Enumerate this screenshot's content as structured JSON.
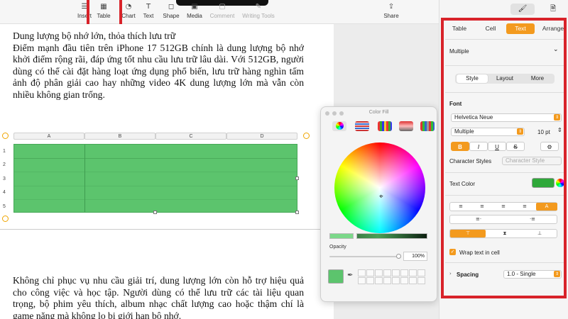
{
  "toolbar": {
    "items": [
      {
        "label": "Insert",
        "icon": "insert-icon"
      },
      {
        "label": "Table",
        "icon": "table-icon"
      },
      {
        "label": "Chart",
        "icon": "chart-icon"
      },
      {
        "label": "Text",
        "icon": "text-icon"
      },
      {
        "label": "Shape",
        "icon": "shape-icon"
      },
      {
        "label": "Media",
        "icon": "media-icon"
      },
      {
        "label": "Comment",
        "icon": "comment-icon"
      },
      {
        "label": "Writing Tools",
        "icon": "writing-tools-icon"
      },
      {
        "label": "Share",
        "icon": "share-icon"
      }
    ]
  },
  "document": {
    "heading": "Dung lượng bộ nhớ lớn, thỏa thích lưu trữ",
    "paragraph1": "Điểm mạnh đầu tiên trên iPhone 17 512GB chính là dung lượng bộ nhớ khởi điểm rộng rãi, đáp ứng tốt nhu cầu lưu trữ lâu dài. Với 512GB, người dùng có thể cài đặt hàng loạt ứng dụng phổ biến, lưu trữ hàng nghìn tấm ảnh độ phân giải cao hay những video 4K dung lượng lớn mà vẫn còn nhiều không gian trống.",
    "paragraph2": "Không chỉ phục vụ nhu cầu giải trí, dung lượng lớn còn hỗ trợ hiệu quả cho công việc và học tập. Người dùng có thể lưu trữ các tài liệu quan trọng, bộ phim yêu thích, album nhạc chất lượng cao hoặc thậm chí là game nặng mà không lo bị giới hạn bộ nhớ.",
    "table": {
      "columns": [
        "A",
        "B",
        "C",
        "D"
      ],
      "rows": [
        "1",
        "2",
        "3",
        "4",
        "5"
      ],
      "fill_color": "#5cc46d"
    }
  },
  "color_fill": {
    "title": "Color Fill",
    "opacity_label": "Opacity",
    "opacity_value": "100%",
    "current_color": "#5cc46d"
  },
  "format_panel": {
    "tabs": [
      "Table",
      "Cell",
      "Text",
      "Arrange"
    ],
    "active_tab": "Text",
    "paragraph_style": "Multiple",
    "subtabs": [
      "Style",
      "Layout",
      "More"
    ],
    "font_label": "Font",
    "font_family": "Helvetica Neue",
    "font_style": "Multiple",
    "font_size": "10 pt",
    "format_buttons": [
      "B",
      "I",
      "U",
      "S"
    ],
    "character_styles_label": "Character Styles",
    "character_style_placeholder": "Character Style",
    "text_color_label": "Text Color",
    "text_color": "#2fa83a",
    "wrap_label": "Wrap text in cell",
    "spacing_label": "Spacing",
    "spacing_value": "1.0 - Single"
  },
  "accent": "#f39a1e",
  "highlight": "#d8232a"
}
